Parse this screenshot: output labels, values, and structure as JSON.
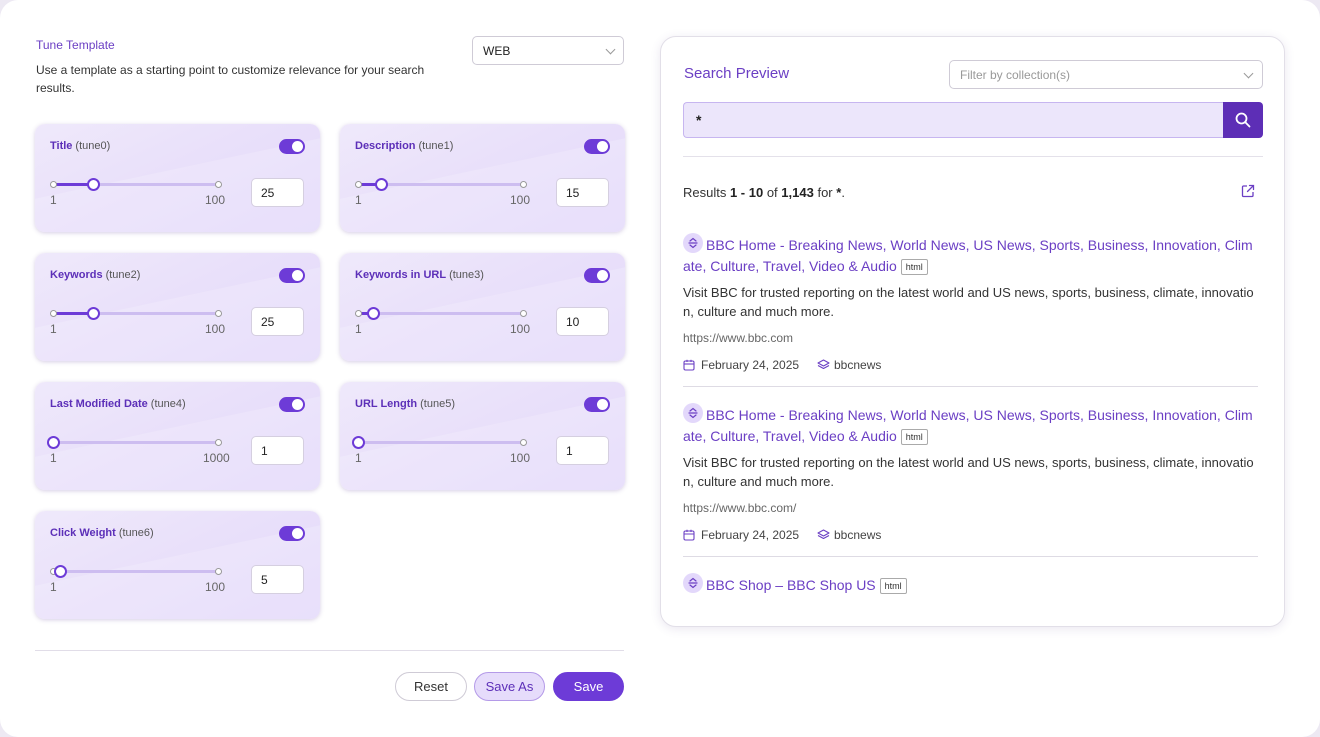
{
  "tune_template": {
    "title": "Tune Template",
    "description": "Use a template as a starting point to customize relevance for your search results.",
    "selected": "WEB"
  },
  "tunes": [
    {
      "label": "Title",
      "key": "(tune0)",
      "enabled": true,
      "min": "1",
      "max": "100",
      "value": "25",
      "fraction": 0.24
    },
    {
      "label": "Description",
      "key": "(tune1)",
      "enabled": true,
      "min": "1",
      "max": "100",
      "value": "15",
      "fraction": 0.14
    },
    {
      "label": "Keywords",
      "key": "(tune2)",
      "enabled": true,
      "min": "1",
      "max": "100",
      "value": "25",
      "fraction": 0.24
    },
    {
      "label": "Keywords in URL",
      "key": "(tune3)",
      "enabled": true,
      "min": "1",
      "max": "100",
      "value": "10",
      "fraction": 0.09
    },
    {
      "label": "Last Modified Date",
      "key": "(tune4)",
      "enabled": true,
      "min": "1",
      "max": "1000",
      "value": "1",
      "fraction": 0.0
    },
    {
      "label": "URL Length",
      "key": "(tune5)",
      "enabled": true,
      "min": "1",
      "max": "100",
      "value": "1",
      "fraction": 0.0
    },
    {
      "label": "Click Weight",
      "key": "(tune6)",
      "enabled": true,
      "min": "1",
      "max": "100",
      "value": "5",
      "fraction": 0.04
    }
  ],
  "actions": {
    "reset": "Reset",
    "save_as": "Save As",
    "save": "Save"
  },
  "preview": {
    "title": "Search Preview",
    "collection_placeholder": "Filter by collection(s)",
    "query": "*",
    "results_summary": {
      "prefix": "Results ",
      "range": "1 - 10",
      "of": " of ",
      "total": "1,143",
      "for": " for ",
      "query": "*",
      "suffix": "."
    },
    "results": [
      {
        "title": "BBC Home - Breaking News, World News, US News, Sports, Business, Innovation, Climate, Culture, Travel, Video & Audio",
        "tag": "html",
        "snippet": "Visit BBC for trusted reporting on the latest world and US news, sports, business, climate, innovation, culture and much more.",
        "url": "https://www.bbc.com",
        "date": "February 24, 2025",
        "collection": "bbcnews"
      },
      {
        "title": "BBC Home - Breaking News, World News, US News, Sports, Business, Innovation, Climate, Culture, Travel, Video & Audio",
        "tag": "html",
        "snippet": "Visit BBC for trusted reporting on the latest world and US news, sports, business, climate, innovation, culture and much more.",
        "url": "https://www.bbc.com/",
        "date": "February 24, 2025",
        "collection": "bbcnews"
      },
      {
        "title": "BBC Shop – BBC Shop US",
        "tag": "html"
      }
    ]
  },
  "colors": {
    "accent": "#6d3bd7",
    "title_purple": "#6b3fc4",
    "search_button": "#5d2eb6",
    "card_bg": "#e9e0fa"
  },
  "icons": {
    "search": "search-icon",
    "external": "external-link-icon",
    "calendar": "calendar-icon",
    "collection": "layers-icon",
    "result": "relevance-icon"
  }
}
